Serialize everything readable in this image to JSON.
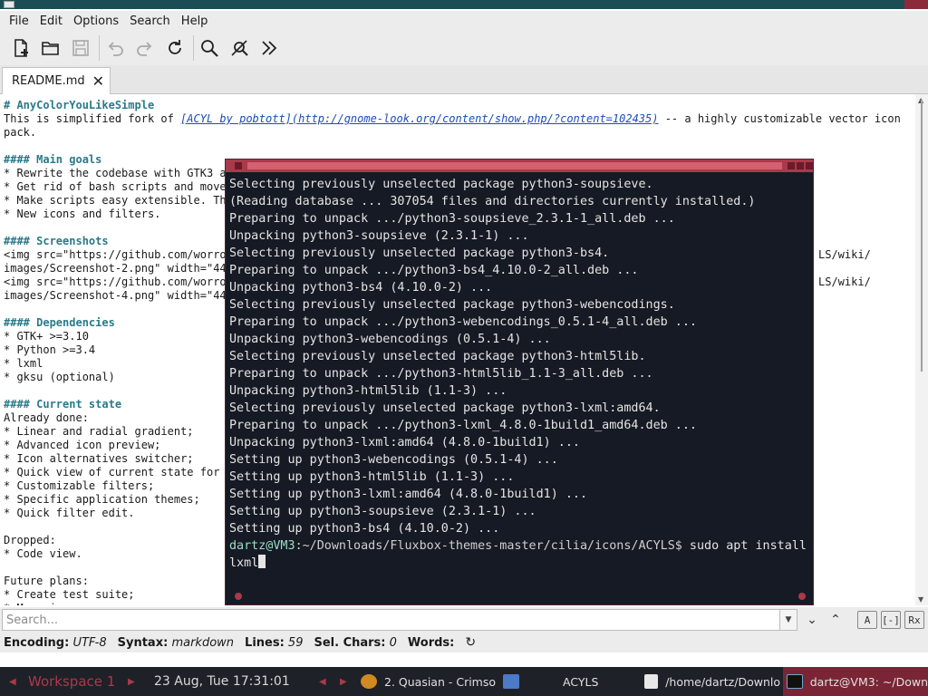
{
  "menu": [
    "File",
    "Edit",
    "Options",
    "Search",
    "Help"
  ],
  "toolbar": {
    "new": "new-file-icon",
    "open": "open-folder-icon",
    "save": "save-icon",
    "undo": "undo-icon",
    "redo": "redo-icon",
    "reload": "reload-icon",
    "find": "search-icon",
    "find_replace": "find-replace-icon",
    "more": "more-chevrons-icon"
  },
  "tab": {
    "label": "README.md"
  },
  "editor": {
    "lines": [
      "# AnyColorYouLikeSimple",
      "This is simplified fork of ",
      "pack.",
      "",
      "#### Main goals",
      "* Rewrite the codebase with GTK3 a",
      "* Get rid of bash scripts and move",
      "* Make scripts easy extensible. Th",
      "* New icons and filters.",
      "",
      "#### Screenshots",
      "<img src=\"https://github.com/worro",
      "images/Screenshot-2.png\" width=\"44",
      "<img src=\"https://github.com/worro",
      "images/Screenshot-4.png\" width=\"44",
      "",
      "#### Dependencies",
      "* GTK+ >=3.10",
      "* Python >=3.4",
      "* lxml",
      "* gksu (optional)",
      "",
      "#### Current state",
      "Already done:",
      "* Linear and radial gradient;",
      "* Advanced icon preview;",
      "* Icon alternatives switcher;",
      "* Quick view of current state for",
      "* Customizable filters;",
      "* Specific application themes;",
      "* Quick filter edit.",
      "",
      "Dropped:",
      "* Code view.",
      "",
      "Future plans:",
      "* Create test suite;",
      "* More icons."
    ],
    "link_text": "[ACYL by pobtott](http://gnome-look.org/content/show.php/?content=102435)",
    "line2_tail": " -- a highly customizable vector icon",
    "right_fragment_1": "LS/wiki/",
    "right_fragment_2": "LS/wiki/"
  },
  "terminal": {
    "lines": [
      "Selecting previously unselected package python3-soupsieve.",
      "(Reading database ... 307054 files and directories currently installed.)",
      "Preparing to unpack .../python3-soupsieve_2.3.1-1_all.deb ...",
      "Unpacking python3-soupsieve (2.3.1-1) ...",
      "Selecting previously unselected package python3-bs4.",
      "Preparing to unpack .../python3-bs4_4.10.0-2_all.deb ...",
      "Unpacking python3-bs4 (4.10.0-2) ...",
      "Selecting previously unselected package python3-webencodings.",
      "Preparing to unpack .../python3-webencodings_0.5.1-4_all.deb ...",
      "Unpacking python3-webencodings (0.5.1-4) ...",
      "Selecting previously unselected package python3-html5lib.",
      "Preparing to unpack .../python3-html5lib_1.1-3_all.deb ...",
      "Unpacking python3-html5lib (1.1-3) ...",
      "Selecting previously unselected package python3-lxml:amd64.",
      "Preparing to unpack .../python3-lxml_4.8.0-1build1_amd64.deb ...",
      "Unpacking python3-lxml:amd64 (4.8.0-1build1) ...",
      "Setting up python3-webencodings (0.5.1-4) ...",
      "Setting up python3-html5lib (1.1-3) ...",
      "Setting up python3-lxml:amd64 (4.8.0-1build1) ...",
      "Setting up python3-soupsieve (2.3.1-1) ...",
      "Setting up python3-bs4 (4.10.0-2) ..."
    ],
    "prompt_user": "dartz@VM3",
    "prompt_path": ":~/Downloads/Fluxbox-themes-master/cilia/icons/ACYLS$",
    "command": " sudo apt install",
    "command_cont": "lxml"
  },
  "search": {
    "placeholder": "Search..."
  },
  "status": {
    "encoding_label": "Encoding:",
    "encoding": "UTF-8",
    "syntax_label": "Syntax:",
    "syntax": "markdown",
    "lines_label": "Lines:",
    "lines": "59",
    "sel_label": "Sel. Chars:",
    "sel": "0",
    "words_label": "Words:"
  },
  "taskbar": {
    "workspace": "Workspace 1",
    "clock": "23 Aug, Tue 17:31:01",
    "tasks": [
      "2. Quasian - Crimso",
      "ACYLS",
      "/home/dartz/Downlo",
      "dartz@VM3: ~/Down"
    ]
  },
  "colors": {
    "accent": "#a83a4a",
    "terminal_bg": "#161a24",
    "heading": "#2a7a8a"
  }
}
